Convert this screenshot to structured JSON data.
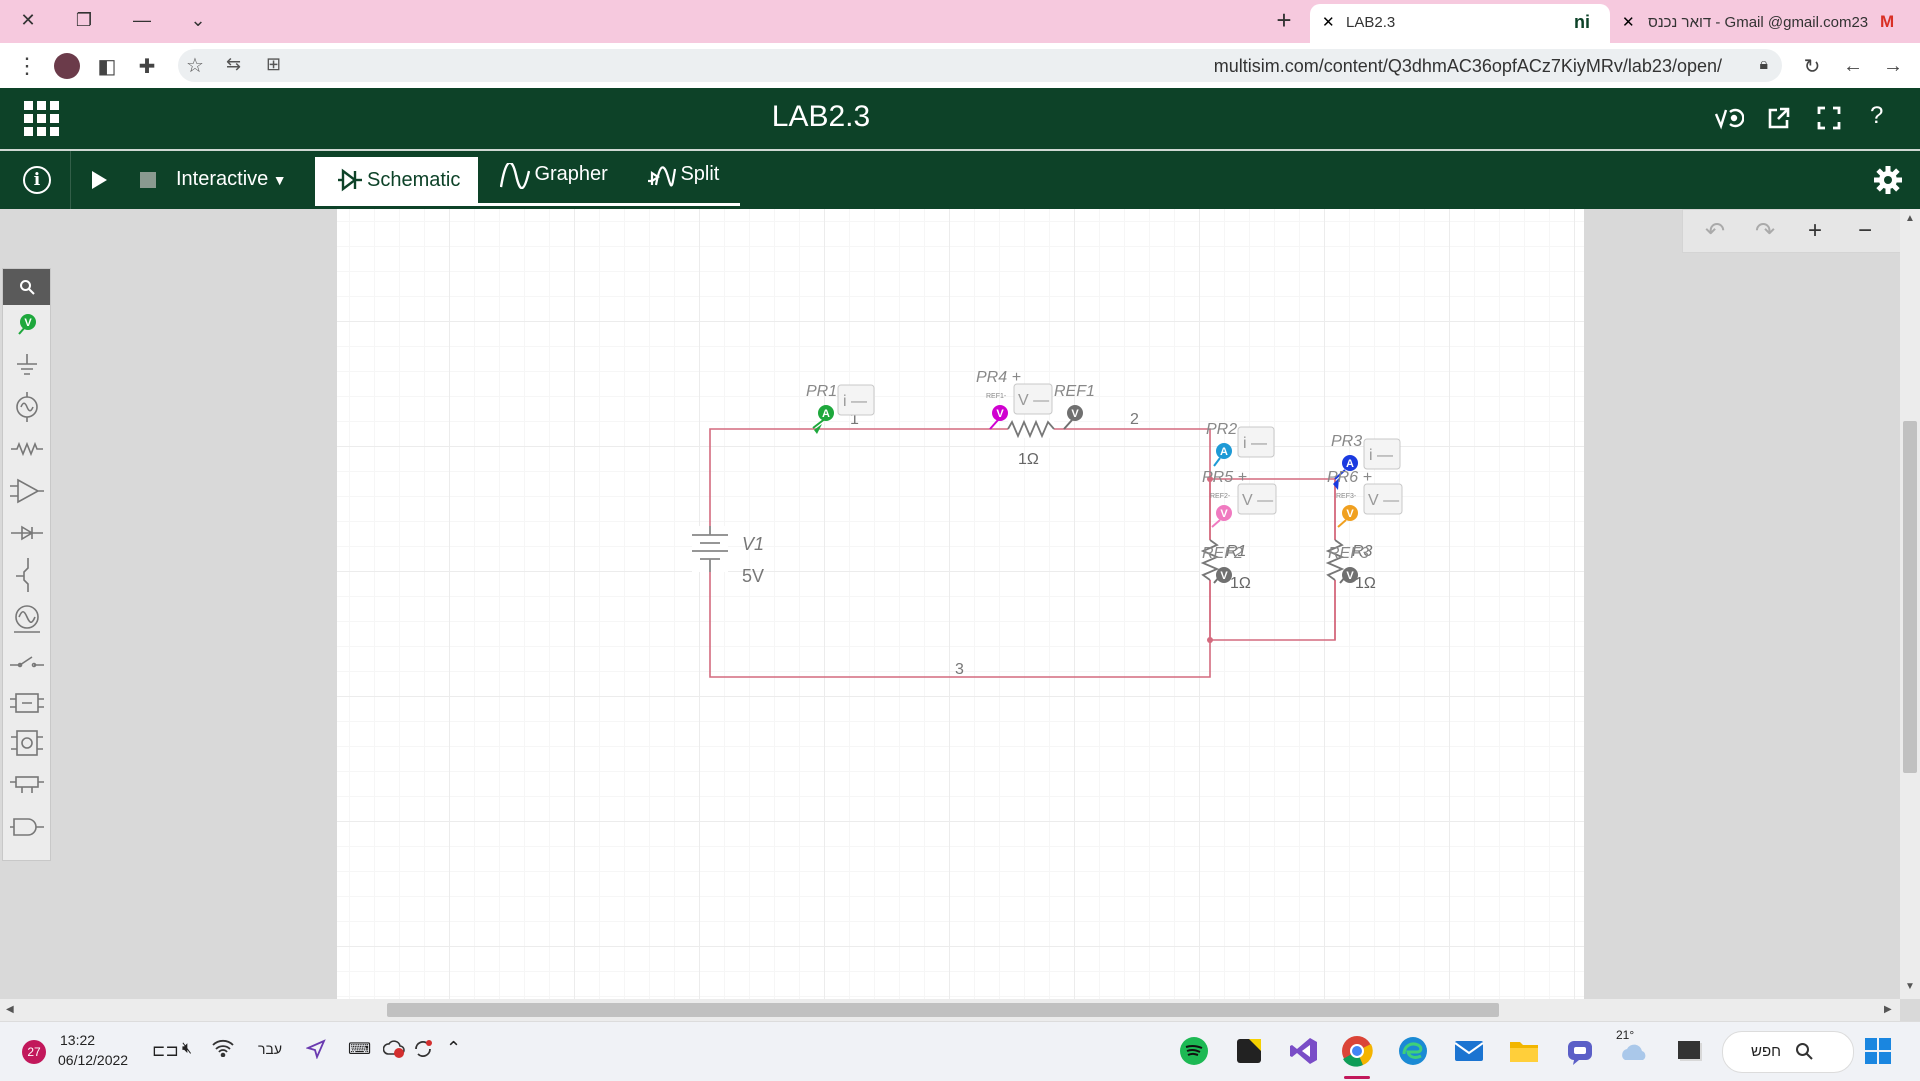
{
  "browser": {
    "tabs": [
      {
        "title": "LAB2.3",
        "active": true
      },
      {
        "title": "דואר נכנס - Gmail @gmail.com23",
        "active": false
      }
    ],
    "url": "multisim.com/content/Q3dhmAC36opfACz7KiyMRv/lab23/open/"
  },
  "app": {
    "title": "LAB2.3",
    "mode_label": "Interactive",
    "tabs": [
      "Schematic",
      "Grapher",
      "Split"
    ],
    "active_tab": "Schematic",
    "header_icons": [
      "measure-icon",
      "share-icon",
      "fullscreen-icon",
      "help-icon"
    ],
    "help_glyph": "?",
    "info_glyph": "i"
  },
  "schematic": {
    "source": {
      "name": "V1",
      "value": "5V"
    },
    "r_top": {
      "value": "1Ω"
    },
    "r1": {
      "name": "R1",
      "value": "1Ω"
    },
    "r3": {
      "name": "R3",
      "value": "1Ω"
    },
    "nodes": {
      "n1": "1",
      "n2": "2",
      "n3": "3"
    },
    "probes": {
      "pr1": {
        "name": "PR1",
        "reading": "i —",
        "type": "A",
        "color": "#1ea83c"
      },
      "pr4": {
        "name": "PR4 +",
        "ref": "REF1-",
        "reading": "V —",
        "type": "V",
        "color": "#d000d0"
      },
      "ref1": {
        "name": "REF1",
        "type": "V",
        "color": "#707070"
      },
      "pr2": {
        "name": "PR2",
        "reading": "i —",
        "type": "A",
        "color": "#1e9ad6"
      },
      "pr5": {
        "name": "PR5 +",
        "ref": "REF2-",
        "reading": "V —",
        "type": "V",
        "color": "#f07ac0"
      },
      "ref2": {
        "name": "REF2",
        "type": "V",
        "color": "#707070"
      },
      "pr3": {
        "name": "PR3",
        "reading": "i —",
        "type": "A",
        "color": "#1a3ae0"
      },
      "pr6": {
        "name": "PR6 +",
        "ref": "REF3-",
        "reading": "V —",
        "type": "V",
        "color": "#f0a020"
      },
      "ref3": {
        "name": "REF3",
        "type": "V",
        "color": "#707070"
      }
    },
    "wire_color": "#d46a7e"
  },
  "taskbar": {
    "time": "13:22",
    "date": "06/12/2022",
    "notification_count": "27",
    "language": "עבר",
    "weather_temp": "21°",
    "search_label": "חפש"
  }
}
